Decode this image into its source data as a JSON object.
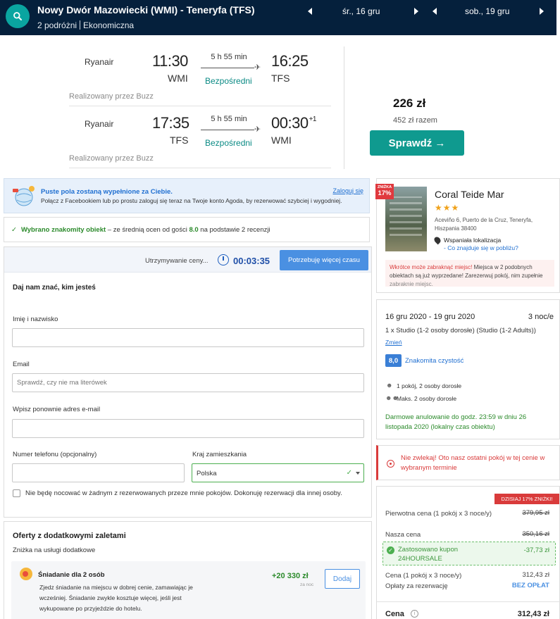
{
  "topbar": {
    "route_title": "Nowy Dwór Mazowiecki (WMI) - Teneryfa (TFS)",
    "travellers": "2 podróżni",
    "cabin": "Ekonomiczna",
    "depart_date": "śr., 16 gru",
    "return_date": "sob., 19 gru",
    "background_color": "#05203c",
    "search_color": "#0aa5a0"
  },
  "flight": {
    "outbound": {
      "airline": "Ryanair",
      "dep_time": "11:30",
      "dep_code": "WMI",
      "duration": "5 h 55 min",
      "stops": "Bezpośredni",
      "arr_time": "16:25",
      "arr_code": "TFS",
      "operated_by": "Realizowany przez Buzz"
    },
    "inbound": {
      "airline": "Ryanair",
      "dep_time": "17:35",
      "dep_code": "TFS",
      "duration": "5 h 55 min",
      "stops": "Bezpośredni",
      "arr_time": "00:30",
      "arr_day_offset": "+1",
      "arr_code": "WMI",
      "operated_by": "Realizowany przez Buzz"
    },
    "price": "226 zł",
    "price_total": "452 zł razem",
    "check_button": "Sprawdź →",
    "check_color": "#0f9a8f"
  },
  "agoda": {
    "facebook": {
      "title": "Puste pola zostaną wypełnione za Ciebie.",
      "description": "Połącz z Facebookiem lub po prostu zaloguj się teraz na Twoje konto Agoda, by rezerwować szybciej i wygodniej.",
      "login": "Zaloguj się"
    },
    "good_choice": {
      "highlight": "Wybrano znakomity obiekt",
      "rest": " – ze średnią ocen od gości ",
      "score": "8.0",
      "suffix": " na podstawie 2 recenzji"
    },
    "hold": {
      "label": "Utrzymywanie ceny...",
      "timer": "00:03:35",
      "more_time_button": "Potrzebuję więcej czasu"
    },
    "form": {
      "heading": "Daj nam znać, kim jesteś",
      "name_label": "Imię i nazwisko",
      "name_value": "",
      "email_label": "Email",
      "email_placeholder": "Sprawdź, czy nie ma literówek",
      "email_confirm_label": "Wpisz ponownie adres e-mail",
      "phone_label": "Numer telefonu (opcjonalny)",
      "country_label": "Kraj zamieszkania",
      "country_value": "Polska",
      "not_staying_label": "Nie będę nocować w żadnym z rezerwowanych przeze mnie pokojów. Dokonuję rezerwacji dla innej osoby."
    },
    "offers": {
      "title": "Oferty z dodatkowymi zaletami",
      "subtitle": "Zniżka na usługi dodatkowe",
      "breakfast_name": "Śniadanie dla 2 osób",
      "breakfast_desc": "Zjedz śniadanie na miejscu w dobrej cenie, zamawiając je wcześniej. Śniadanie zwykle kosztuje więcej, jeśli jest wykupowane po przyjeździe do hotelu.",
      "breakfast_price": "+20 330 zł",
      "breakfast_per": "za noc",
      "add_button": "Dodaj"
    },
    "hotel": {
      "discount_small": "ZNIŻKA",
      "discount": "17%",
      "name": "Coral Teide Mar",
      "stars": "★★★",
      "address": "Aceviño 6, Puerto de la Cruz, Teneryfa, Hiszpania 38400",
      "location": "Wspaniała lokalizacja",
      "nearby": "- Co znajduje się w pobliżu?",
      "hurry_red": "Wkrótce może zabraknąć miejsc!",
      "hurry_rest": " Miejsca w 2 podobnych obiektach są już wyprzedane! Zarezerwuj pokój, nim zupełnie ",
      "hurry_fade": "zabraknie miejsc."
    },
    "stay": {
      "dates": "16 gru 2020 - 19 gru 2020",
      "nights": "3 noc/e",
      "room": "1 x Studio (1-2 osoby dorosłe) (Studio (1-2 Adults))",
      "change": "Zmień",
      "score": "8,0",
      "score_label": "Znakomita czystość",
      "occupancy": "1 pokój, 2 osoby dorosłe",
      "max_occupancy": "Maks. 2 osoby dorosłe",
      "cancellation": "Darmowe anulowanie do godz. 23:59 w dniu 26 listopada 2020 (lokalny czas obiektu)"
    },
    "last_room": "Nie zwlekaj! Oto nasz ostatni pokój w tej cenie w wybranym terminie",
    "prices": {
      "today_badge": "DZISIAJ 17% ZNIŻKI!",
      "original_label": "Pierwotna cena (1 pokój x 3 noce/y)",
      "original_value": "379,95 zł",
      "our_label": "Nasza cena",
      "our_value": "350,16 zł",
      "coupon_label": "Zastosowano kupon",
      "coupon_code": "24HOURSALE",
      "coupon_value": "-37,73 zł",
      "room_price_label": "Cena (1 pokój x 3 noce/y)",
      "room_price_value": "312,43 zł",
      "fees_label": "Opłaty za rezerwację",
      "fees_value": "BEZ OPŁAT",
      "total_label": "Cena",
      "total_value": "312,43 zł"
    }
  }
}
